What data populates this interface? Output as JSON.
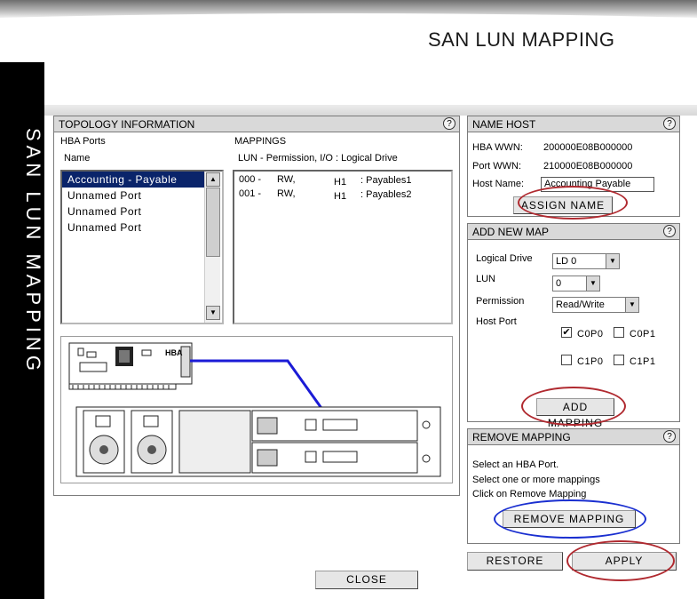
{
  "page": {
    "title": "SAN LUN MAPPING",
    "sidebar_label": "SAN LUN MAPPING"
  },
  "topology": {
    "header": "TOPOLOGY INFORMATION",
    "hba_ports_label": "HBA Ports",
    "name_label": "Name",
    "mappings_label": "MAPPINGS",
    "mappings_columns": "LUN - Permission, I/O  : Logical Drive",
    "ports": [
      {
        "label": "Accounting - Payable",
        "selected": true
      },
      {
        "label": "Unnamed Port",
        "selected": false
      },
      {
        "label": "Unnamed Port",
        "selected": false
      },
      {
        "label": "Unnamed Port",
        "selected": false
      }
    ],
    "mappings": [
      {
        "lun": "000 -",
        "perm": "RW,",
        "io": "H1",
        "drive": ": Payables1"
      },
      {
        "lun": "001 -",
        "perm": "RW,",
        "io": "H1",
        "drive": ": Payables2"
      }
    ],
    "hba_card_label": "HBA"
  },
  "name_host": {
    "header": "NAME HOST",
    "hba_wwn_label": "HBA WWN:",
    "hba_wwn": "200000E08B000000",
    "port_wwn_label": "Port WWN:",
    "port_wwn": "210000E08B000000",
    "host_name_label": "Host Name:",
    "host_name": "Accounting Payable",
    "assign_button": "ASSIGN NAME"
  },
  "add_map": {
    "header": "ADD NEW MAP",
    "logical_drive_label": "Logical Drive",
    "logical_drive_value": "LD 0",
    "lun_label": "LUN",
    "lun_value": "0",
    "permission_label": "Permission",
    "permission_value": "Read/Write",
    "host_port_label": "Host Port",
    "ports": [
      {
        "label": "C0P0",
        "checked": true
      },
      {
        "label": "C0P1",
        "checked": false
      },
      {
        "label": "C1P0",
        "checked": false
      },
      {
        "label": "C1P1",
        "checked": false
      }
    ],
    "add_button": "ADD MAPPING"
  },
  "remove_map": {
    "header": "REMOVE MAPPING",
    "instruction_1": "Select an HBA Port.",
    "instruction_2": "Select one or more mappings",
    "instruction_3": "Click on Remove Mapping",
    "remove_button": "REMOVE MAPPING"
  },
  "footer": {
    "restore_button": "RESTORE",
    "apply_button": "APPLY",
    "close_button": "CLOSE"
  },
  "help_glyph": "?",
  "check_glyph": "✔",
  "colors": {
    "selection": "#0a246a",
    "highlight_red": "#b02a30",
    "highlight_blue": "#1a2fd0",
    "cable_blue": "#1b1bd6",
    "sidebar": "#000000"
  }
}
